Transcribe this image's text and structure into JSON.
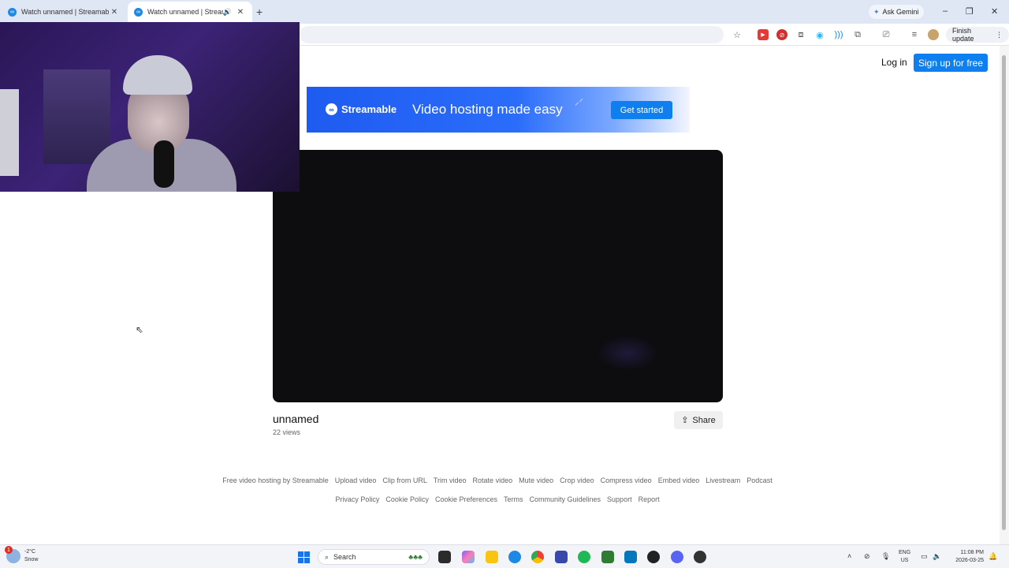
{
  "browser": {
    "tabs": [
      {
        "title": "Watch unnamed | Streamable",
        "active": false
      },
      {
        "title": "Watch unnamed | Streamabl",
        "active": true
      }
    ],
    "new_tab": "+",
    "ask_gemini": "Ask Gemini",
    "finish_update": "Finish update",
    "window_controls": {
      "minimize": "–",
      "restore": "❐",
      "close": "✕"
    }
  },
  "page": {
    "login": "Log in",
    "signup": "Sign up for free",
    "banner": {
      "brand": "Streamable",
      "tagline": "Video hosting made easy",
      "cta": "Get started"
    },
    "video": {
      "title": "unnamed",
      "views": "22 views",
      "share": "Share"
    },
    "footer": {
      "row1": [
        "Free video hosting by Streamable",
        "Upload video",
        "Clip from URL",
        "Trim video",
        "Rotate video",
        "Mute video",
        "Crop video",
        "Compress video",
        "Embed video",
        "Livestream",
        "Podcast"
      ],
      "row2": [
        "Privacy Policy",
        "Cookie Policy",
        "Cookie Preferences",
        "Terms",
        "Community Guidelines",
        "Support",
        "Report"
      ]
    }
  },
  "taskbar": {
    "weather_temp": "-2°C",
    "weather_cond": "Snow",
    "weather_badge": "1",
    "search": "Search",
    "lang_top": "ENG",
    "lang_bottom": "US",
    "time": "11:08 PM",
    "date": "2026-03-25"
  },
  "colors": {
    "accent": "#0f7ff0",
    "banner_blue": "#1e5bf0",
    "tabstrip": "#dfe7f4"
  }
}
